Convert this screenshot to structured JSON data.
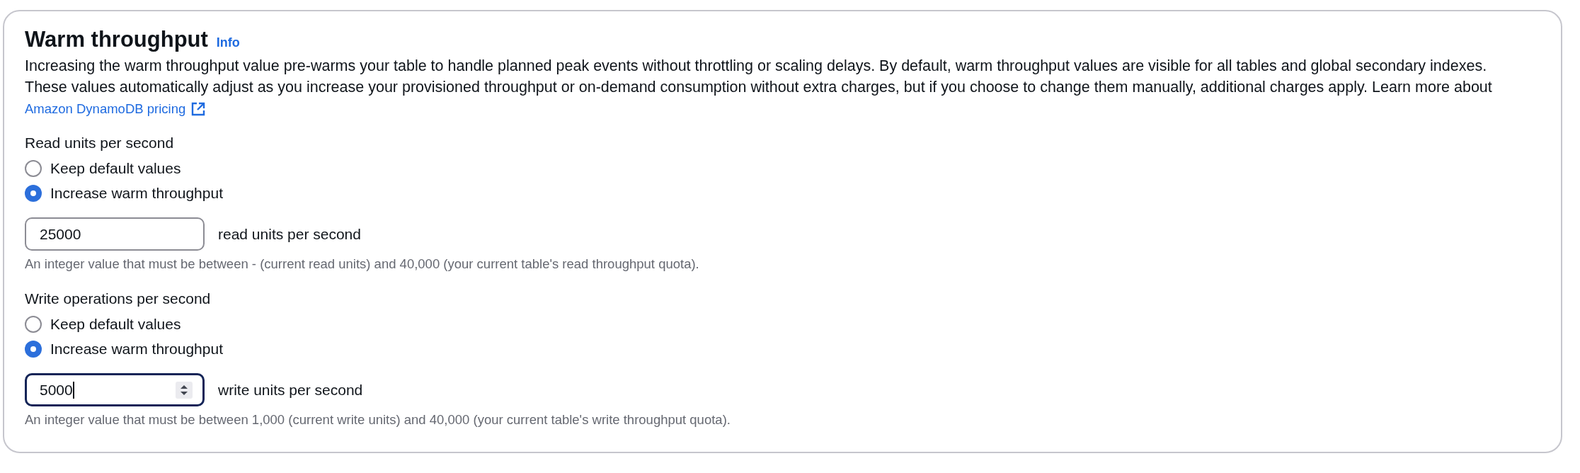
{
  "section": {
    "title": "Warm throughput",
    "info_link": "Info",
    "description_lines": [
      "Increasing the warm throughput value pre-warms your table to handle planned peak events without throttling or scaling delays. By default, warm throughput values are visible for all tables and global secondary indexes.",
      "These values automatically adjust as you increase your provisioned throughput or on-demand consumption without extra charges, but if you choose to change them manually, additional charges apply. Learn more about"
    ],
    "pricing_link": "Amazon DynamoDB pricing"
  },
  "groups": [
    {
      "label": "Read units per second",
      "options": [
        {
          "label": "Keep default values",
          "selected": false
        },
        {
          "label": "Increase warm throughput",
          "selected": true
        }
      ],
      "input": {
        "value": "25000",
        "focused": false
      },
      "unit": "read units per second",
      "hint": "An integer value that must be between - (current read units) and 40,000 (your current table's read throughput quota)."
    },
    {
      "label": "Write operations per second",
      "options": [
        {
          "label": "Keep default values",
          "selected": false
        },
        {
          "label": "Increase warm throughput",
          "selected": true
        }
      ],
      "input": {
        "value": "5000",
        "focused": true
      },
      "unit": "write units per second",
      "hint": "An integer value that must be between 1,000 (current write units) and 40,000 (your current table's write throughput quota)."
    }
  ]
}
